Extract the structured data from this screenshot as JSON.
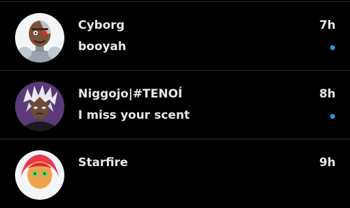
{
  "theme": {
    "background": "#000000",
    "text": "#e7e9ea",
    "divider": "#2f3336",
    "unread_dot": "#1d9bf0"
  },
  "conversations": [
    {
      "name": "Cyborg",
      "time": "7h",
      "preview": "booyah",
      "unread": true,
      "avatar_icon": "cyborg-avatar"
    },
    {
      "name": "Niggojo|#TENOÍ",
      "time": "8h",
      "preview": "I miss your scent",
      "unread": true,
      "avatar_icon": "white-haired-character-avatar"
    },
    {
      "name": "Starfire",
      "time": "9h",
      "avatar_icon": "starfire-avatar"
    }
  ]
}
